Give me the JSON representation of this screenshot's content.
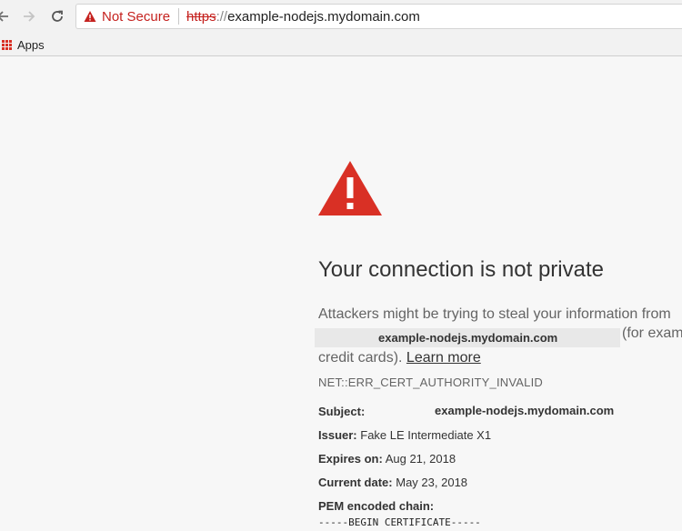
{
  "browser": {
    "security_label": "Not Secure",
    "url_scheme": "https",
    "url_sep": "://",
    "url_host": "example-nodejs.mydomain.com",
    "bookmarks_apps_label": "Apps",
    "warning_color": "#c5221f"
  },
  "page": {
    "heading": "Your connection is not private",
    "intro_text": "Attackers might be trying to steal your information from",
    "highlighted_host": "example-nodejs.mydomain.com",
    "for_example_text": "(for examp",
    "credit_text": "credit cards).",
    "learn_more": "Learn more",
    "error_code": "NET::ERR_CERT_AUTHORITY_INVALID",
    "subject_label": "Subject:",
    "subject_value": "example-nodejs.mydomain.com",
    "issuer_label": "Issuer:",
    "issuer_value": "Fake LE Intermediate X1",
    "expires_label": "Expires on:",
    "expires_value": "Aug 21, 2018",
    "current_label": "Current date:",
    "current_value": "May 23, 2018",
    "pem_label": "PEM encoded chain:",
    "pem_first_line": "-----BEGIN CERTIFICATE-----",
    "alert_icon_color": "#d93025"
  }
}
